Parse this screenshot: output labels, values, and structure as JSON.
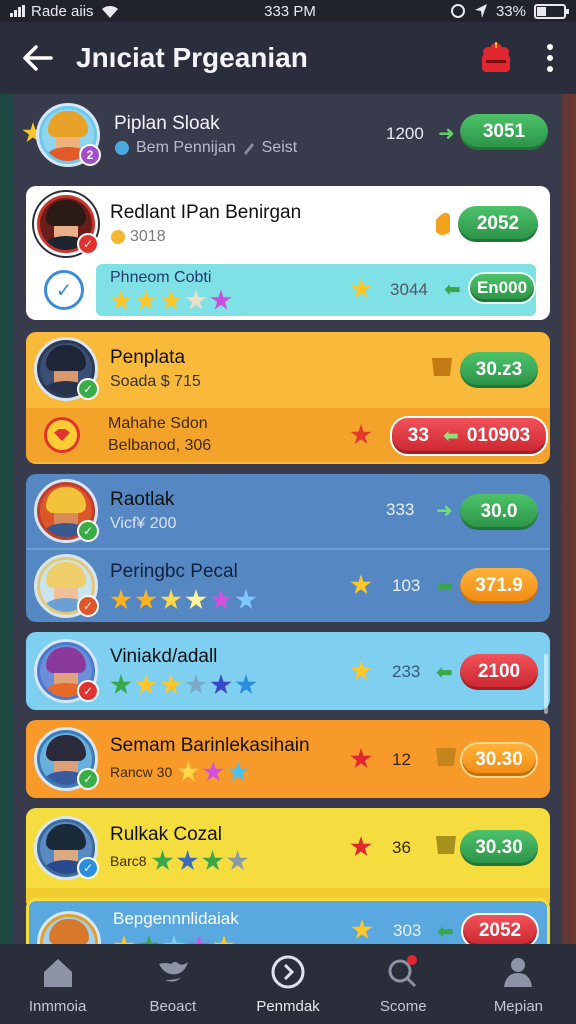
{
  "status_bar": {
    "carrier": "Rade aiis",
    "time": "333 PM",
    "battery": "33%"
  },
  "app_bar": {
    "title": "Jnıciat Prgeanian"
  },
  "top_player": {
    "name": "Piplan Sloak",
    "sub_left": "Bem Pennijan",
    "sub_right": "Seist",
    "score": "1200",
    "pill": "3051"
  },
  "cards": [
    {
      "theme": "white",
      "row1": {
        "name": "Redlant IPan Benirgan",
        "sub": "3018",
        "pill": "2052",
        "pill_color": "green"
      },
      "row2": {
        "name": "Phneom Cobti",
        "score": "3044",
        "pill": "En000",
        "pill_color": "green"
      }
    },
    {
      "theme": "orange",
      "row1": {
        "name": "Penplata",
        "sub": "Soada $ 715",
        "pill": "30.z3",
        "pill_color": "green"
      },
      "row2": {
        "name": "Mahahe Sdon",
        "sub": "Belbanod, 306",
        "score": "33",
        "pill": "010903",
        "pill_color": "red"
      }
    },
    {
      "theme": "blue",
      "row1": {
        "name": "Raotlak",
        "sub": "Vicf¥ 200",
        "score": "333",
        "pill": "30.0",
        "pill_color": "green"
      },
      "row2": {
        "name": "Peringbc Pecal",
        "score": "103",
        "pill": "371.9",
        "pill_color": "orange"
      }
    },
    {
      "theme": "lightblue",
      "row1": {
        "name": "Viniakd/adall",
        "score": "233",
        "pill": "2100",
        "pill_color": "red"
      }
    },
    {
      "theme": "deeporange",
      "row1": {
        "name": "Semam Barinlekasihain",
        "sub": "Rancw 30",
        "score": "12",
        "pill": "30.30",
        "pill_color": "orange"
      }
    },
    {
      "theme": "yellow",
      "row1": {
        "name": "Rulkak Cozal",
        "sub": "Barc8",
        "score": "36",
        "pill": "30.30",
        "pill_color": "green"
      }
    },
    {
      "theme": "partial",
      "row1": {
        "name": "Bepgennnlidaiak",
        "score": "303",
        "pill": "2052",
        "pill_color": "red"
      }
    }
  ],
  "nav": [
    {
      "label": "Inmmoia",
      "icon": "home-icon"
    },
    {
      "label": "Beoact",
      "icon": "bird-icon"
    },
    {
      "label": "Penmdak",
      "icon": "play-circle-icon"
    },
    {
      "label": "Scome",
      "icon": "search-notification-icon"
    },
    {
      "label": "Mepian",
      "icon": "profile-icon"
    }
  ]
}
